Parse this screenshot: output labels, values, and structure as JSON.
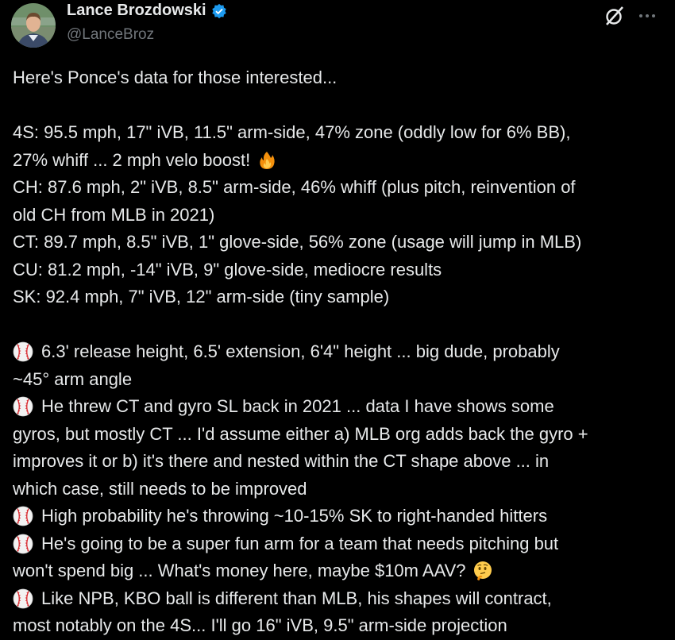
{
  "author": {
    "display_name": "Lance Brozdowski",
    "handle": "@LanceBroz",
    "verified": true
  },
  "icons": {
    "verified": "verified-badge-icon",
    "grok": "grok-icon",
    "more": "more-options-icon",
    "fire": "fire-emoji",
    "baseball": "baseball-emoji",
    "thinking": "thinking-face-emoji"
  },
  "colors": {
    "background": "#000000",
    "text": "#e7e9ea",
    "secondary": "#71767b",
    "verified": "#1d9bf0"
  },
  "tweet": {
    "intro": "Here's Ponce's data for those interested...",
    "pitches": {
      "l1": "4S: 95.5 mph, 17\" iVB, 11.5\" arm-side, 47% zone (oddly low for 6% BB),",
      "l2": "27% whiff ... 2 mph velo boost!",
      "l3": "CH: 87.6 mph, 2\" iVB, 8.5\" arm-side, 46% whiff (plus pitch, reinvention of",
      "l4": "old CH from MLB in 2021)",
      "l5": "CT: 89.7 mph, 8.5\" iVB, 1\" glove-side, 56% zone (usage will jump in MLB)",
      "l6": "CU: 81.2 mph, -14\" iVB, 9\" glove-side, mediocre results",
      "l7": "SK: 92.4 mph, 7\" iVB, 12\" arm-side (tiny sample)"
    },
    "notes": {
      "n1a": "6.3' release height, 6.5' extension, 6'4\" height ... big dude, probably",
      "n1b": "~45° arm angle",
      "n2a": "He threw CT and gyro SL back in 2021 ... data I have shows some",
      "n2b": "gyros, but mostly CT ... I'd assume either a) MLB org adds back the gyro +",
      "n2c": "improves it or b) it's there and nested within the CT shape above ... in",
      "n2d": "which case, still needs to be improved",
      "n3": "High probability he's throwing ~10-15% SK to right-handed hitters",
      "n4a": "He's going to be a super fun arm for a team that needs pitching but",
      "n4b": "won't spend big ... What's money here, maybe $10m AAV?",
      "n5a": "Like NPB, KBO ball is different than MLB, his shapes will contract,",
      "n5b": "most notably on the 4S... I'll go 16\" iVB, 9.5\" arm-side projection"
    }
  }
}
